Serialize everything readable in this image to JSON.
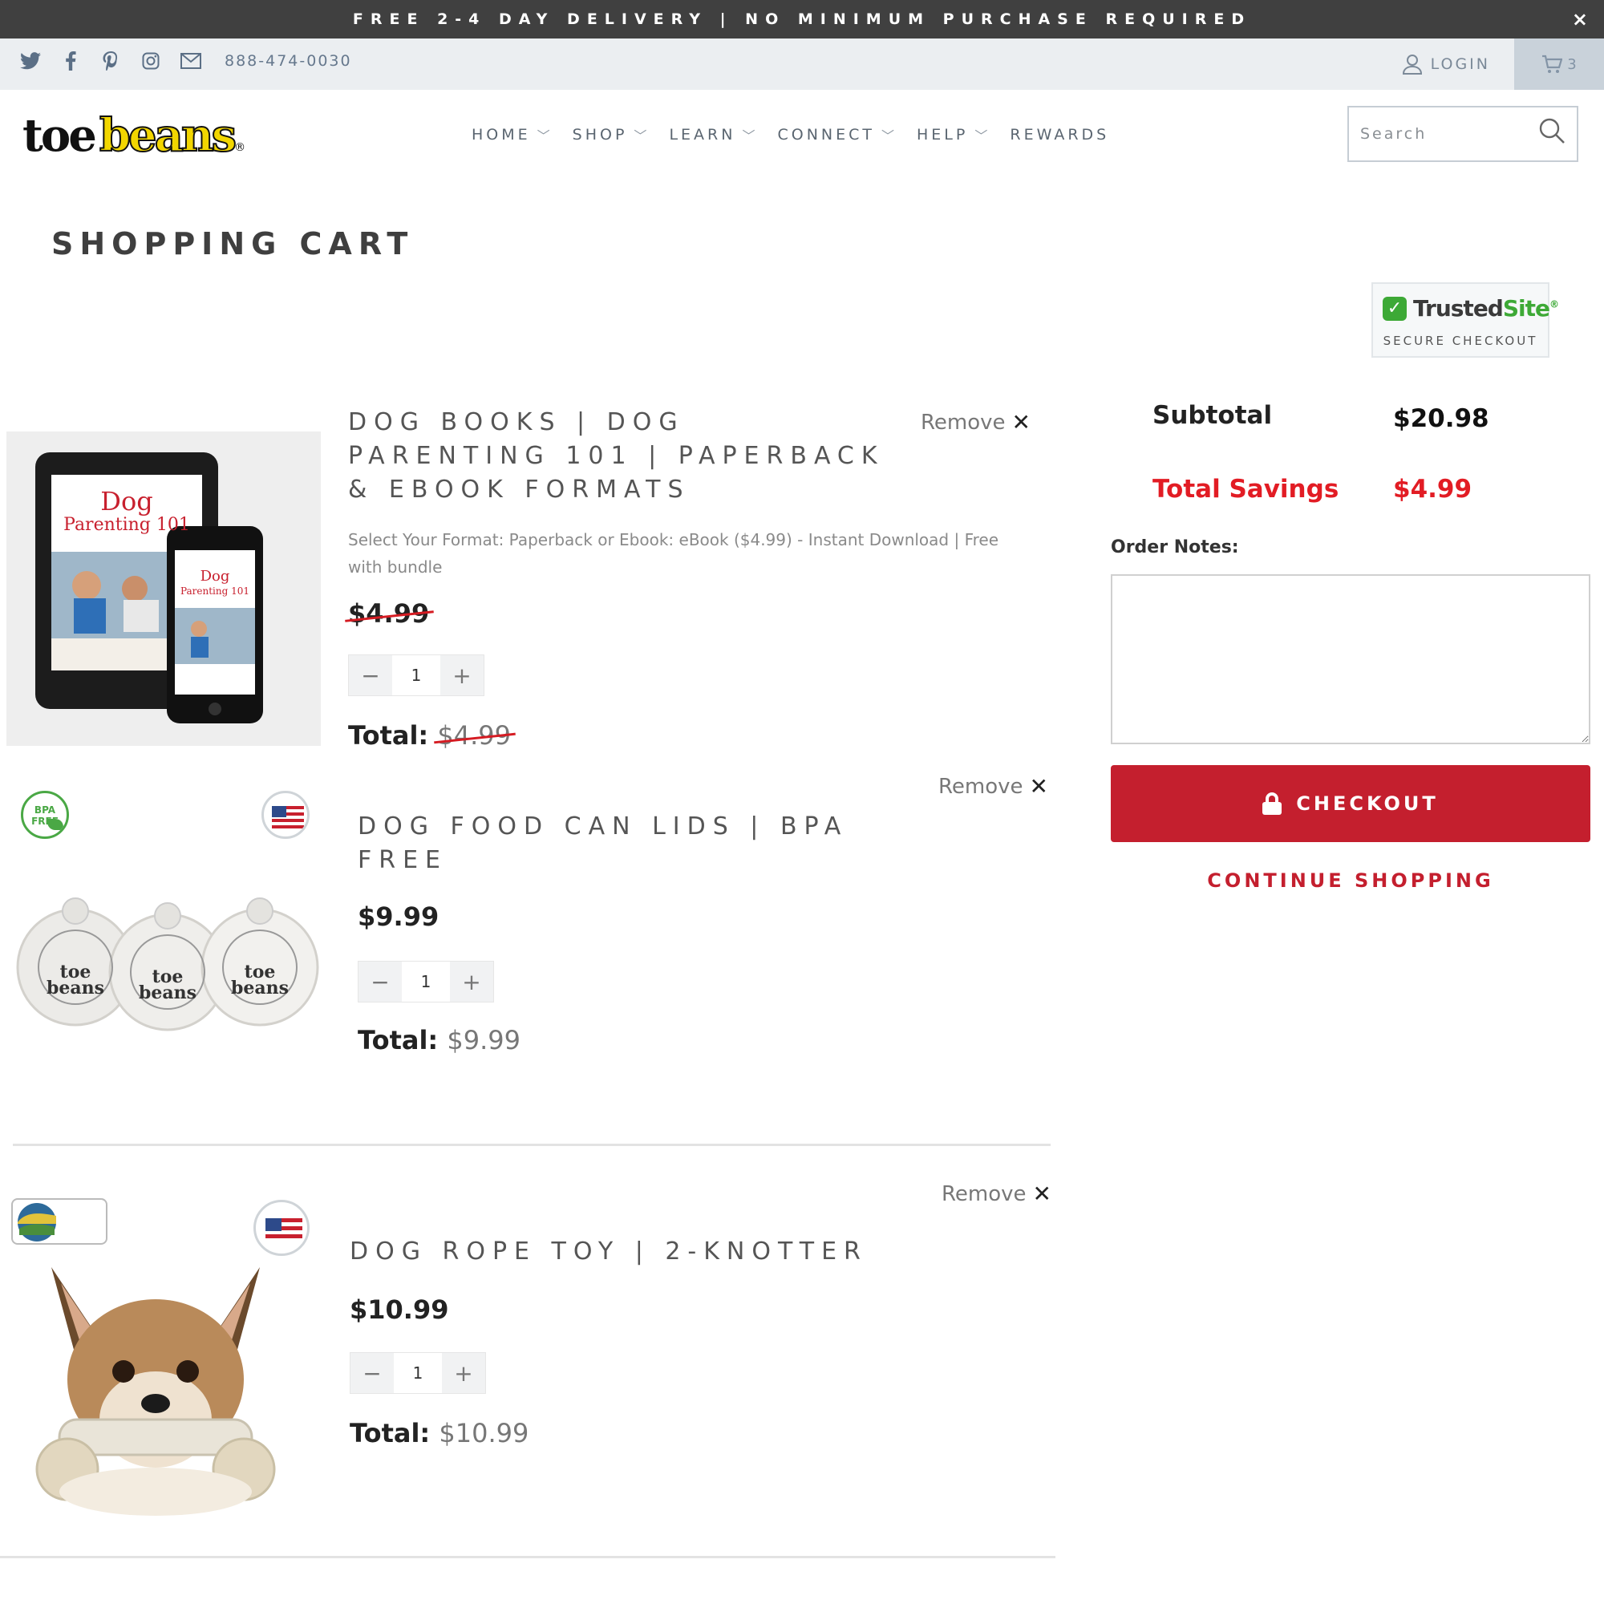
{
  "announcement": {
    "text": "FREE 2-4 DAY DELIVERY | NO MINIMUM PURCHASE REQUIRED",
    "close": "×"
  },
  "utility": {
    "phone": "888-474-0030",
    "login": "LOGIN",
    "cart_count": "3"
  },
  "logo": {
    "part1": "toe",
    "part2": "beans",
    "mark": "®"
  },
  "nav": [
    {
      "label": "HOME",
      "has_dropdown": true
    },
    {
      "label": "SHOP",
      "has_dropdown": true
    },
    {
      "label": "LEARN",
      "has_dropdown": true
    },
    {
      "label": "CONNECT",
      "has_dropdown": true
    },
    {
      "label": "HELP",
      "has_dropdown": true
    },
    {
      "label": "REWARDS",
      "has_dropdown": false
    }
  ],
  "search": {
    "placeholder": "Search"
  },
  "page": {
    "title": "SHOPPING CART"
  },
  "trusted": {
    "brand_a": "Trusted",
    "brand_b": "Site",
    "tm": "®",
    "subtitle": "SECURE CHECKOUT"
  },
  "items": [
    {
      "title": "DOG BOOKS | DOG PARENTING 101 | PAPERBACK & EBOOK FORMATS",
      "variant": "Select Your Format: Paperback or Ebook: eBook ($4.99) - Instant Download | Free with bundle",
      "price": "$4.99",
      "price_struck": true,
      "quantity": "1",
      "total_label": "Total:",
      "total": "$4.99",
      "total_struck": true,
      "remove": "Remove"
    },
    {
      "title": "DOG FOOD CAN LIDS | BPA FREE",
      "price": "$9.99",
      "price_struck": false,
      "quantity": "1",
      "total_label": "Total:",
      "total": "$9.99",
      "total_struck": false,
      "remove": "Remove"
    },
    {
      "title": "DOG ROPE TOY | 2-KNOTTER",
      "price": "$10.99",
      "price_struck": false,
      "quantity": "1",
      "total_label": "Total:",
      "total": "$10.99",
      "total_struck": false,
      "remove": "Remove"
    }
  ],
  "book_cover": {
    "line1": "Dog",
    "line2": "Parenting 101"
  },
  "lid_text": {
    "a": "toe",
    "b": "beans"
  },
  "badges": {
    "bpa": "BPA FREE"
  },
  "summary": {
    "subtotal_label": "Subtotal",
    "subtotal": "$20.98",
    "savings_label": "Total Savings",
    "savings": "$4.99",
    "notes_label": "Order Notes:",
    "checkout": "CHECKOUT",
    "continue": "CONTINUE SHOPPING"
  },
  "colors": {
    "accent": "#c41f2e",
    "savings": "#e21c24",
    "announce_bg": "#404040"
  }
}
